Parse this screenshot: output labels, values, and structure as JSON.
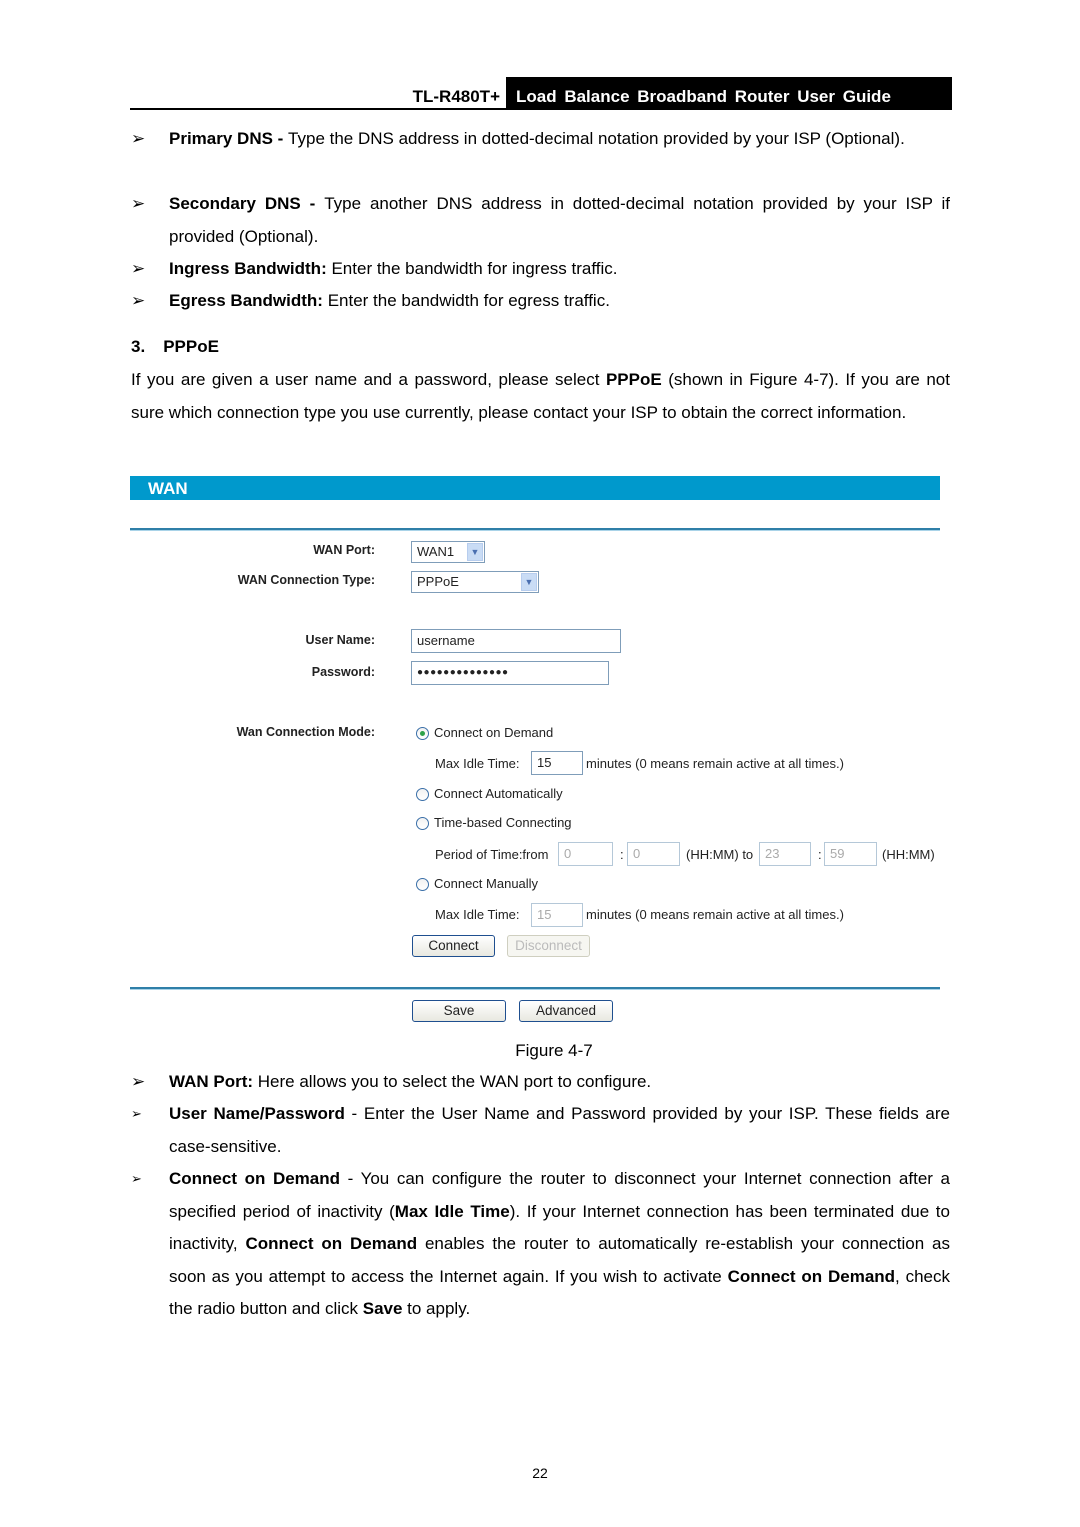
{
  "header": {
    "model": "TL-R480T+",
    "guide_title": "Load Balance Broadband Router User Guide"
  },
  "intro_bullets": [
    {
      "term": "Primary DNS",
      "sep": " - ",
      "text": "Type the DNS address in dotted-decimal notation provided by your ISP (Optional)."
    },
    {
      "term": "Secondary DNS",
      "sep": " - ",
      "text": "Type another DNS address in dotted-decimal notation provided by your ISP if provided (Optional)."
    },
    {
      "term": "Ingress Bandwidth:",
      "sep": " ",
      "text": "Enter the bandwidth for ingress traffic."
    },
    {
      "term": "Egress Bandwidth:",
      "sep": " ",
      "text": "Enter the bandwidth for egress traffic."
    }
  ],
  "section": {
    "number": "3.",
    "title": "PPPoE",
    "para_before": "If you are given a user name and a password, please select ",
    "para_bold": "PPPoE",
    "para_after": " (shown in Figure 4-7). If you are not sure which connection type you use currently, please contact your ISP to obtain the correct information."
  },
  "figure": {
    "panel_title": "WAN",
    "wan_port_label": "WAN Port:",
    "wan_port_value": "WAN1",
    "conn_type_label": "WAN Connection Type:",
    "conn_type_value": "PPPoE",
    "user_name_label": "User Name:",
    "user_name_value": "username",
    "password_label": "Password:",
    "password_value": "●●●●●●●●●●●●●●",
    "mode_label": "Wan Connection Mode:",
    "modes": [
      {
        "label": "Connect on Demand",
        "selected": true
      },
      {
        "label": "Connect Automatically",
        "selected": false
      },
      {
        "label": "Time-based Connecting",
        "selected": false
      },
      {
        "label": "Connect Manually",
        "selected": false
      }
    ],
    "max_idle_label": "Max Idle Time:",
    "max_idle_value_demand": "15",
    "max_idle_value_manual": "15",
    "minutes_note": "minutes (0 means remain active at all times.)",
    "period_label": "Period of Time:from",
    "from_hh": "0",
    "from_mm": "0",
    "colon": ":",
    "hhmm_to": "(HH:MM) to",
    "to_hh": "23",
    "to_mm": "59",
    "hhmm": "(HH:MM)",
    "connect_label": "Connect",
    "disconnect_label": "Disconnect",
    "save_label": "Save",
    "advanced_label": "Advanced",
    "caption": "Figure 4-7"
  },
  "desc_bullets": [
    {
      "term": "WAN Port:",
      "text": " Here allows you to select the WAN port to configure."
    },
    {
      "term": "User Name/Password",
      "text": " - Enter the User Name and Password provided by your ISP. These fields are case-sensitive."
    }
  ],
  "cod": {
    "t1": "Connect on Demand",
    "t2": " - You can configure the router to disconnect your Internet connection after a specified period of inactivity (",
    "t3": "Max Idle Time",
    "t4": "). If your Internet connection has been terminated due to inactivity, ",
    "t5": "Connect on Demand",
    "t6": " enables the router to automatically re-establish your connection as soon as you attempt to access the Internet again. If you wish to activate ",
    "t7": "Connect on Demand",
    "t8": ", check the radio button and click ",
    "t9": "Save",
    "t10": " to apply."
  },
  "page_number": "22"
}
